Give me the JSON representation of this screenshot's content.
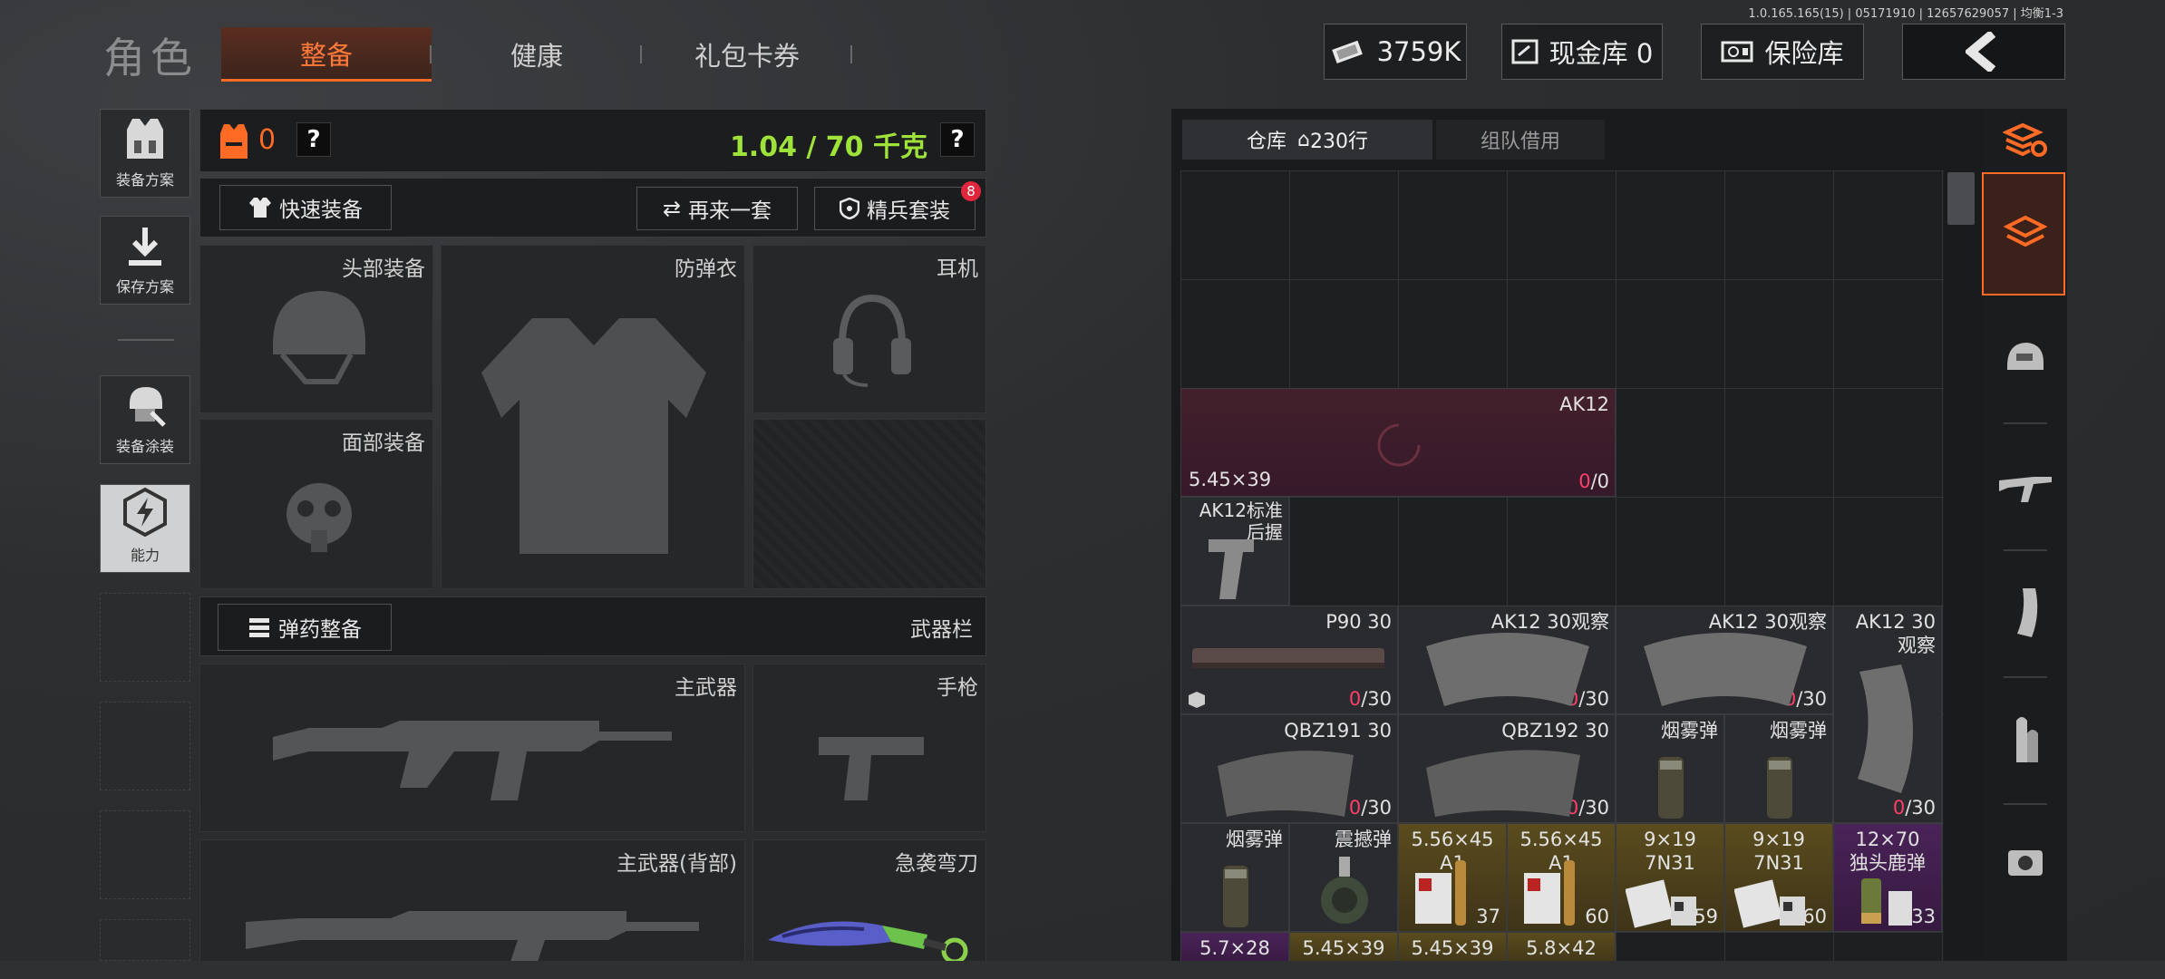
{
  "version": "1.0.165.165(15) | 05171910 | 12657629057 | 均衡1-3",
  "header": {
    "title": "角色",
    "tabs": [
      "整备",
      "健康",
      "礼包卡券"
    ],
    "money": "3759K",
    "cash_vault": "现金库 0",
    "safe": "保险库"
  },
  "left_menu": [
    "装备方案",
    "保存方案",
    "装备涂装",
    "能力"
  ],
  "loadout": {
    "armor_count": "0",
    "weight": "1.04 / 70 千克",
    "help": "?",
    "quick_equip": "快速装备",
    "again": "再来一套",
    "elite": "精兵套装",
    "elite_badge": "8",
    "slots": {
      "head": "头部装备",
      "vest": "防弹衣",
      "headset": "耳机",
      "face": "面部装备"
    },
    "ammo_equip": "弹药整备",
    "weapons_title": "武器栏",
    "weapons": {
      "primary": "主武器",
      "pistol": "手枪",
      "primary_back": "主武器(背部)",
      "melee": "急袭弯刀"
    }
  },
  "warehouse": {
    "tab_label": "仓库",
    "rows": "230行",
    "team_tab": "组队借用",
    "items": {
      "ak12": {
        "name": "AK12",
        "caliber": "5.45×39",
        "zero": "0",
        "cap": "/0"
      },
      "grip": {
        "name": "AK12标准后握"
      },
      "p90": {
        "name": "P90 30",
        "zero": "0",
        "cap": "/30"
      },
      "ak_obs1": {
        "name": "AK12 30观察",
        "zero": "0",
        "cap": "/30"
      },
      "ak_obs2": {
        "name": "AK12 30观察",
        "zero": "0",
        "cap": "/30"
      },
      "ak_obs3": {
        "name": "AK12 30观察",
        "zero": "0",
        "cap": "/30"
      },
      "qbz191": {
        "name": "QBZ191 30",
        "zero": "0",
        "cap": "/30"
      },
      "qbz192": {
        "name": "QBZ192 30",
        "zero": "0",
        "cap": "/30"
      },
      "smoke1": {
        "name": "烟雾弹"
      },
      "smoke2": {
        "name": "烟雾弹"
      },
      "smoke3": {
        "name": "烟雾弹"
      },
      "flash": {
        "name": "震撼弹"
      },
      "a556_1": {
        "name": "5.56×45",
        "sub": "A1",
        "count": "37"
      },
      "a556_2": {
        "name": "5.56×45",
        "sub": "A1",
        "count": "60"
      },
      "a919_1": {
        "name": "9×19",
        "sub": "7N31",
        "count": "59"
      },
      "a919_2": {
        "name": "9×19",
        "sub": "7N31",
        "count": "60"
      },
      "a1270": {
        "name": "12×70",
        "sub": "独头鹿弹",
        "count": "33"
      },
      "bottom": [
        "5.7×28",
        "5.45×39",
        "5.45×39",
        "5.8×42"
      ]
    }
  },
  "colors": {
    "accent": "#ff6a24",
    "weight": "#9ee23a",
    "zero": "#ff3f6b",
    "gold_cell": "#5a4c1e",
    "purple_cell": "#4a2358"
  }
}
